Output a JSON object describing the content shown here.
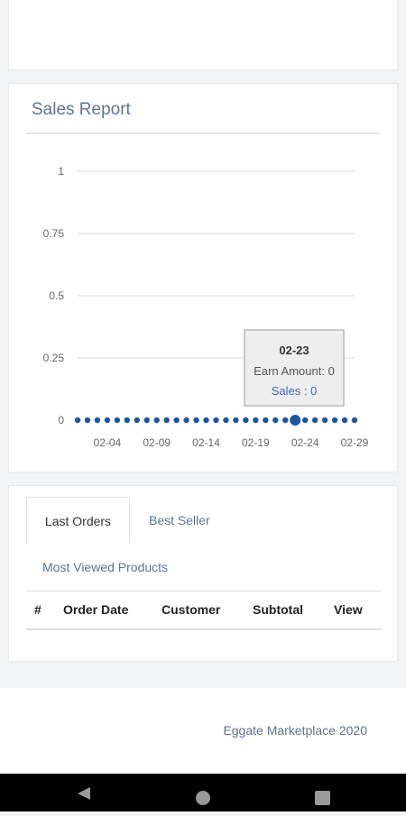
{
  "sales_report": {
    "title": "Sales Report"
  },
  "chart_data": {
    "type": "line",
    "y_ticks": [
      "1",
      "0.75",
      "0.5",
      "0.25",
      "0"
    ],
    "ylim": [
      0,
      1
    ],
    "x_ticks": [
      "02-04",
      "02-09",
      "02-14",
      "02-19",
      "02-24",
      "02-29"
    ],
    "series": [
      {
        "color": "#1f55a0",
        "x": [
          "02-01",
          "02-02",
          "02-03",
          "02-04",
          "02-05",
          "02-06",
          "02-07",
          "02-08",
          "02-09",
          "02-10",
          "02-11",
          "02-12",
          "02-13",
          "02-14",
          "02-15",
          "02-16",
          "02-17",
          "02-18",
          "02-19",
          "02-20",
          "02-21",
          "02-22",
          "02-23",
          "02-24",
          "02-25",
          "02-26",
          "02-27",
          "02-28",
          "02-29"
        ],
        "values": [
          0,
          0,
          0,
          0,
          0,
          0,
          0,
          0,
          0,
          0,
          0,
          0,
          0,
          0,
          0,
          0,
          0,
          0,
          0,
          0,
          0,
          0,
          0,
          0,
          0,
          0,
          0,
          0,
          0
        ]
      }
    ],
    "highlighted": "02-23",
    "grid": true
  },
  "tooltip": {
    "date": "02-23",
    "earn": "Earn Amount: 0",
    "sales": "Sales : 0"
  },
  "tabs": {
    "last_orders": "Last Orders",
    "best_seller": "Best Seller",
    "most_viewed": "Most Viewed Products"
  },
  "orders_table": {
    "headers": [
      "#",
      "Order Date",
      "Customer",
      "Subtotal",
      "View"
    ]
  },
  "footer": {
    "text": "Eggate Marketplace 2020"
  },
  "colors": {
    "accent": "#5f7391",
    "point": "#1f55a0",
    "navbar": "#000000"
  }
}
